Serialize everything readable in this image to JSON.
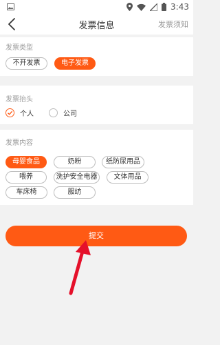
{
  "status_bar": {
    "time": "3:43"
  },
  "header": {
    "title": "发票信息",
    "right_link": "发票须知"
  },
  "invoice_type": {
    "title": "发票类型",
    "options": [
      {
        "label": "不开发票",
        "selected": false
      },
      {
        "label": "电子发票",
        "selected": true
      }
    ]
  },
  "invoice_header": {
    "title": "发票抬头",
    "options": [
      {
        "label": "个人",
        "selected": true
      },
      {
        "label": "公司",
        "selected": false
      }
    ]
  },
  "invoice_content": {
    "title": "发票内容",
    "options": [
      {
        "label": "母婴食品",
        "selected": true
      },
      {
        "label": "奶粉",
        "selected": false
      },
      {
        "label": "纸防尿用品",
        "selected": false
      },
      {
        "label": "喂养",
        "selected": false
      },
      {
        "label": "洗护安全电器",
        "selected": false
      },
      {
        "label": "文体用品",
        "selected": false
      },
      {
        "label": "车床椅",
        "selected": false
      },
      {
        "label": "服纺",
        "selected": false
      }
    ]
  },
  "submit": {
    "label": "提交"
  },
  "colors": {
    "accent": "#ff5a14",
    "arrow": "#e5102a"
  }
}
